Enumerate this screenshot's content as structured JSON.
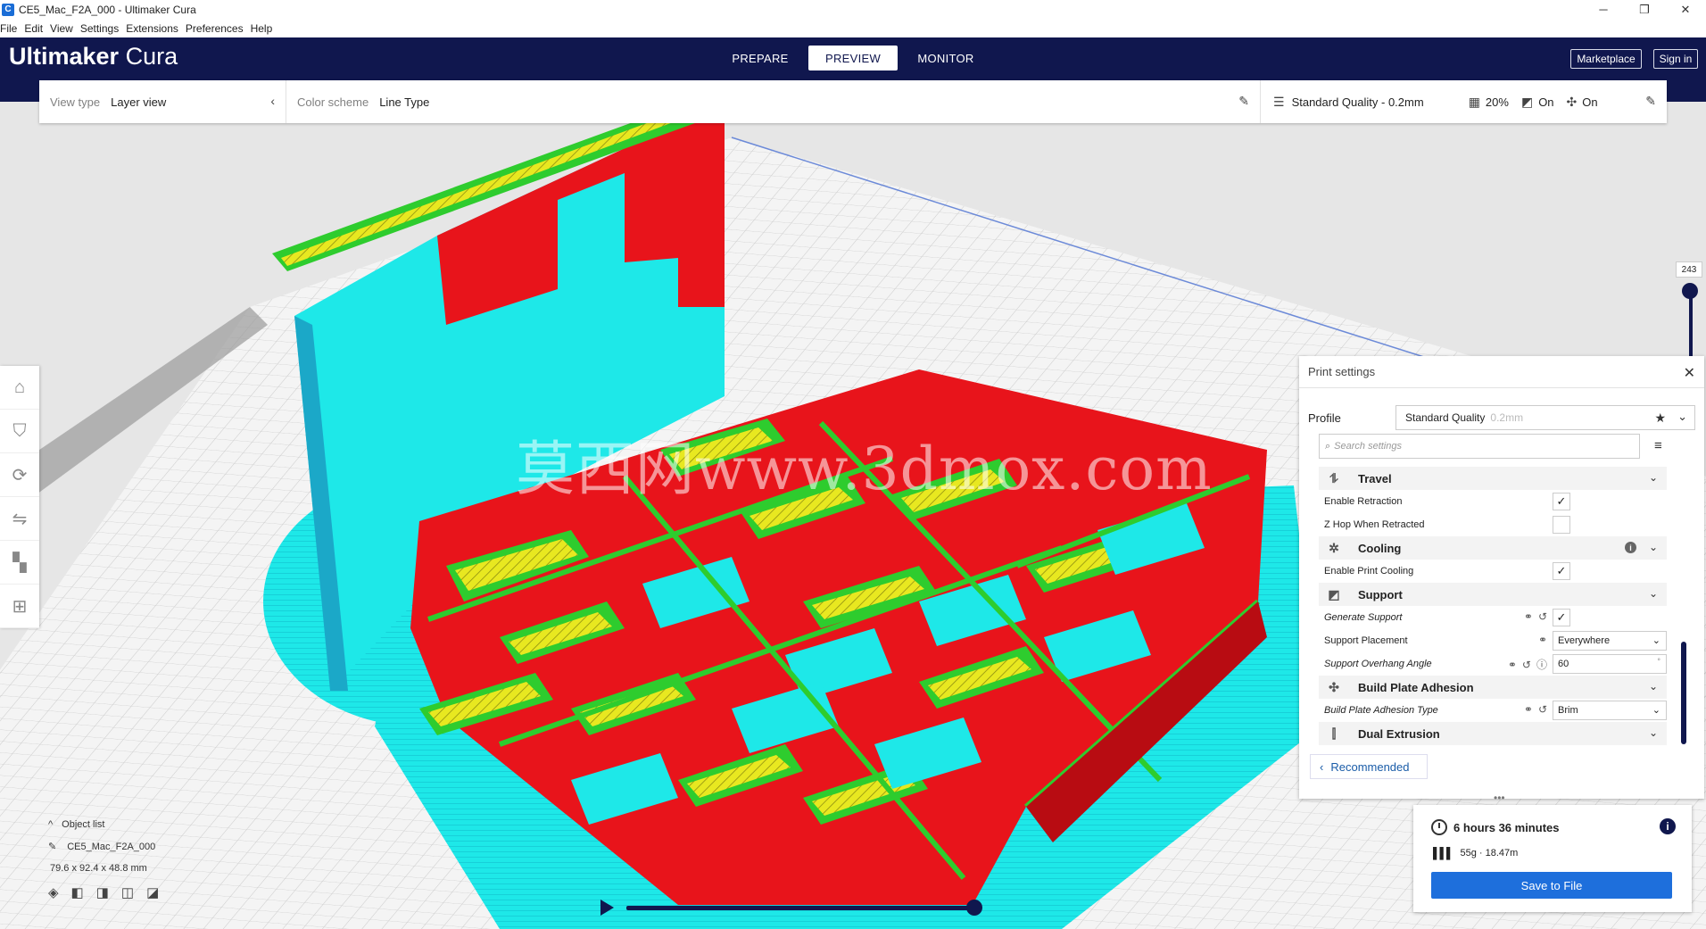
{
  "window": {
    "title": "CE5_Mac_F2A_000 - Ultimaker Cura",
    "app_icon": "C",
    "controls": {
      "minimize": "─",
      "maximize": "❐",
      "close": "✕"
    }
  },
  "menu": [
    "File",
    "Edit",
    "View",
    "Settings",
    "Extensions",
    "Preferences",
    "Help"
  ],
  "header": {
    "brand_bold": "Ultimaker",
    "brand_light": "Cura",
    "tabs": [
      {
        "label": "PREPARE",
        "active": false
      },
      {
        "label": "PREVIEW",
        "active": true
      },
      {
        "label": "MONITOR",
        "active": false
      }
    ],
    "marketplace": "Marketplace",
    "signin": "Sign in"
  },
  "toolbar": {
    "view_type_label": "View type",
    "view_type_value": "Layer view",
    "color_scheme_label": "Color scheme",
    "color_scheme_value": "Line Type",
    "quality": "Standard Quality - 0.2mm",
    "infill": "20%",
    "support": "On",
    "adhesion": "On"
  },
  "viewport": {
    "watermark": "莫西网www.3dmox.com",
    "layer_number": "243",
    "colors": {
      "red": "#e8141b",
      "cyan": "#1ee8e8",
      "green": "#2ecc2e",
      "yellow": "#e8e820",
      "blue": "#4a6ad8"
    }
  },
  "left_tools": [
    "prime-tower-icon",
    "support-icon",
    "rotate-icon",
    "mirror-icon",
    "per-model-icon",
    "support-blocker-icon"
  ],
  "object_list": {
    "title": "Object list",
    "name": "CE5_Mac_F2A_000",
    "dims": "79.6 x 92.4 x 48.8 mm"
  },
  "print_settings": {
    "title": "Print settings",
    "profile_label": "Profile",
    "profile_value": "Standard Quality",
    "profile_dim": "0.2mm",
    "search_placeholder": "Search settings",
    "categories": {
      "travel": "Travel",
      "cooling": "Cooling",
      "support": "Support",
      "adhesion": "Build Plate Adhesion",
      "dual": "Dual Extrusion"
    },
    "settings": {
      "enable_retraction": "Enable Retraction",
      "z_hop": "Z Hop When Retracted",
      "enable_cooling": "Enable Print Cooling",
      "generate_support": "Generate Support",
      "support_placement": "Support Placement",
      "support_placement_value": "Everywhere",
      "overhang_angle": "Support Overhang Angle",
      "overhang_angle_value": "60",
      "overhang_unit": "°",
      "adhesion_type": "Build Plate Adhesion Type",
      "adhesion_type_value": "Brim"
    },
    "recommended": "Recommended"
  },
  "action": {
    "time": "6 hours 36 minutes",
    "material": "55g · 18.47m",
    "save": "Save to File"
  }
}
